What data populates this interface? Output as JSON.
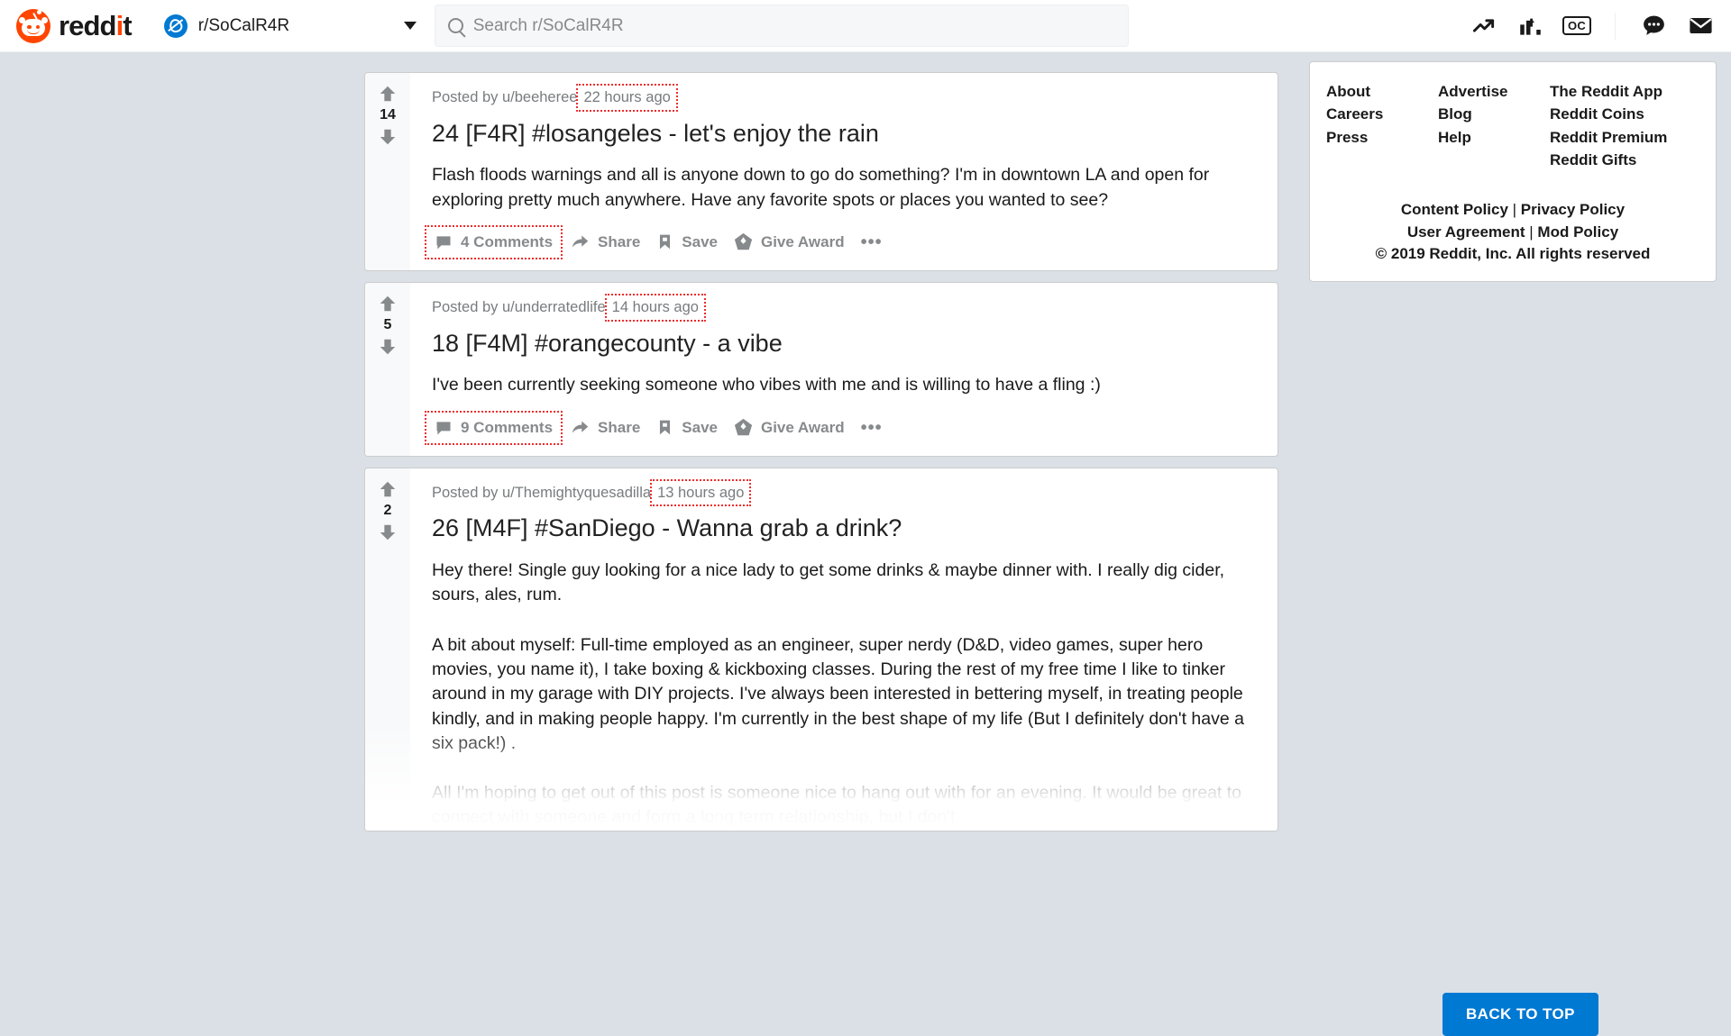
{
  "header": {
    "brand_name": "reddit",
    "brand_color": "#FF4500",
    "subreddit": "r/SoCalR4R",
    "search": {
      "placeholder": "Search r/SoCalR4R",
      "value": ""
    },
    "icons": [
      {
        "name": "trending-icon",
        "glyph": "trending"
      },
      {
        "name": "bar-chart-icon",
        "glyph": "barchart"
      },
      {
        "name": "original-content-icon",
        "glyph": "OC"
      },
      {
        "name": "chat-icon",
        "glyph": "chat"
      },
      {
        "name": "mail-icon",
        "glyph": "mail"
      }
    ]
  },
  "feed": {
    "posts": [
      {
        "score": "14",
        "posted_by": "Posted by u/beeheree",
        "timestamp": "22 hours ago",
        "title": "24 [F4R] #losangeles - let's enjoy the rain",
        "paragraphs": [
          "Flash floods warnings and all is anyone down to go do something? I'm in downtown LA and open for exploring pretty much anywhere. Have any favorite spots or places you wanted to see?"
        ],
        "comments_label": "4 Comments",
        "share_label": "Share",
        "save_label": "Save",
        "award_label": "Give Award",
        "more_label": "•••"
      },
      {
        "score": "5",
        "posted_by": "Posted by u/underratedlife",
        "timestamp": "14 hours ago",
        "title": "18 [F4M] #orangecounty - a vibe",
        "paragraphs": [
          "I've been currently seeking someone who vibes with me and is willing to have a fling :)"
        ],
        "comments_label": "9 Comments",
        "share_label": "Share",
        "save_label": "Save",
        "award_label": "Give Award",
        "more_label": "•••"
      },
      {
        "score": "2",
        "posted_by": "Posted by u/Themightyquesadilla",
        "timestamp": "13 hours ago",
        "title": "26 [M4F] #SanDiego - Wanna grab a drink?",
        "paragraphs": [
          "Hey there! Single guy looking for a nice lady to get some drinks & maybe dinner with. I really dig cider, sours, ales, rum.",
          "A bit about myself: Full-time employed as an engineer, super nerdy (D&D, video games, super hero movies, you name it), I take boxing & kickboxing classes. During the rest of my free time I like to tinker around in my garage with DIY projects. I've always been interested in bettering myself, in treating people kindly, and in making people happy. I'm currently in the best shape of my life (But I definitely don't have a six pack!) .",
          "All I'm hoping to get out of this post is someone nice to hang out with for an evening. It would be great to connect with someone and form a long term relationship, but I don't"
        ]
      }
    ]
  },
  "sidebar": {
    "columns": [
      {
        "links": [
          "About",
          "Careers",
          "Press"
        ]
      },
      {
        "links": [
          "Advertise",
          "Blog",
          "Help"
        ]
      },
      {
        "links": [
          "The Reddit App",
          "Reddit Coins",
          "Reddit Premium",
          "Reddit Gifts"
        ]
      }
    ],
    "policy_rows": [
      {
        "left": "Content Policy",
        "sep": "|",
        "right": "Privacy Policy"
      },
      {
        "left": "User Agreement",
        "sep": "|",
        "right": "Mod Policy"
      }
    ],
    "copyright": "© 2019 Reddit, Inc. All rights reserved"
  },
  "back_to_top": {
    "label": "BACK TO TOP",
    "color": "#0079D3"
  }
}
